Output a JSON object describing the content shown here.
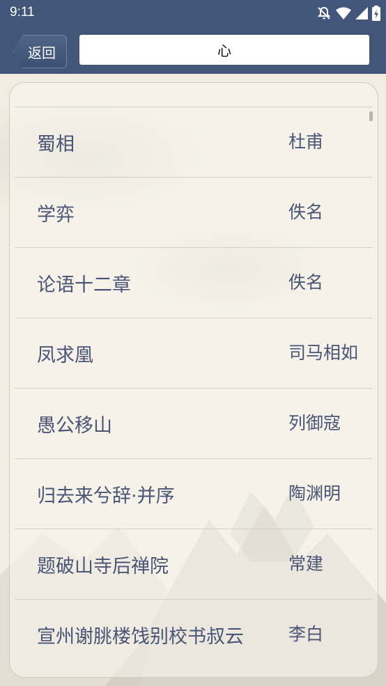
{
  "status": {
    "time": "9:11"
  },
  "header": {
    "back_label": "返回",
    "search_value": "心"
  },
  "poems": [
    {
      "title": "蜀相",
      "author": "杜甫"
    },
    {
      "title": "学弈",
      "author": "佚名"
    },
    {
      "title": "论语十二章",
      "author": "佚名"
    },
    {
      "title": "凤求凰",
      "author": "司马相如"
    },
    {
      "title": "愚公移山",
      "author": "列御寇"
    },
    {
      "title": "归去来兮辞·并序",
      "author": "陶渊明"
    },
    {
      "title": "题破山寺后禅院",
      "author": "常建"
    },
    {
      "title": "宣州谢朓楼饯别校书叔云",
      "author": "李白"
    }
  ]
}
